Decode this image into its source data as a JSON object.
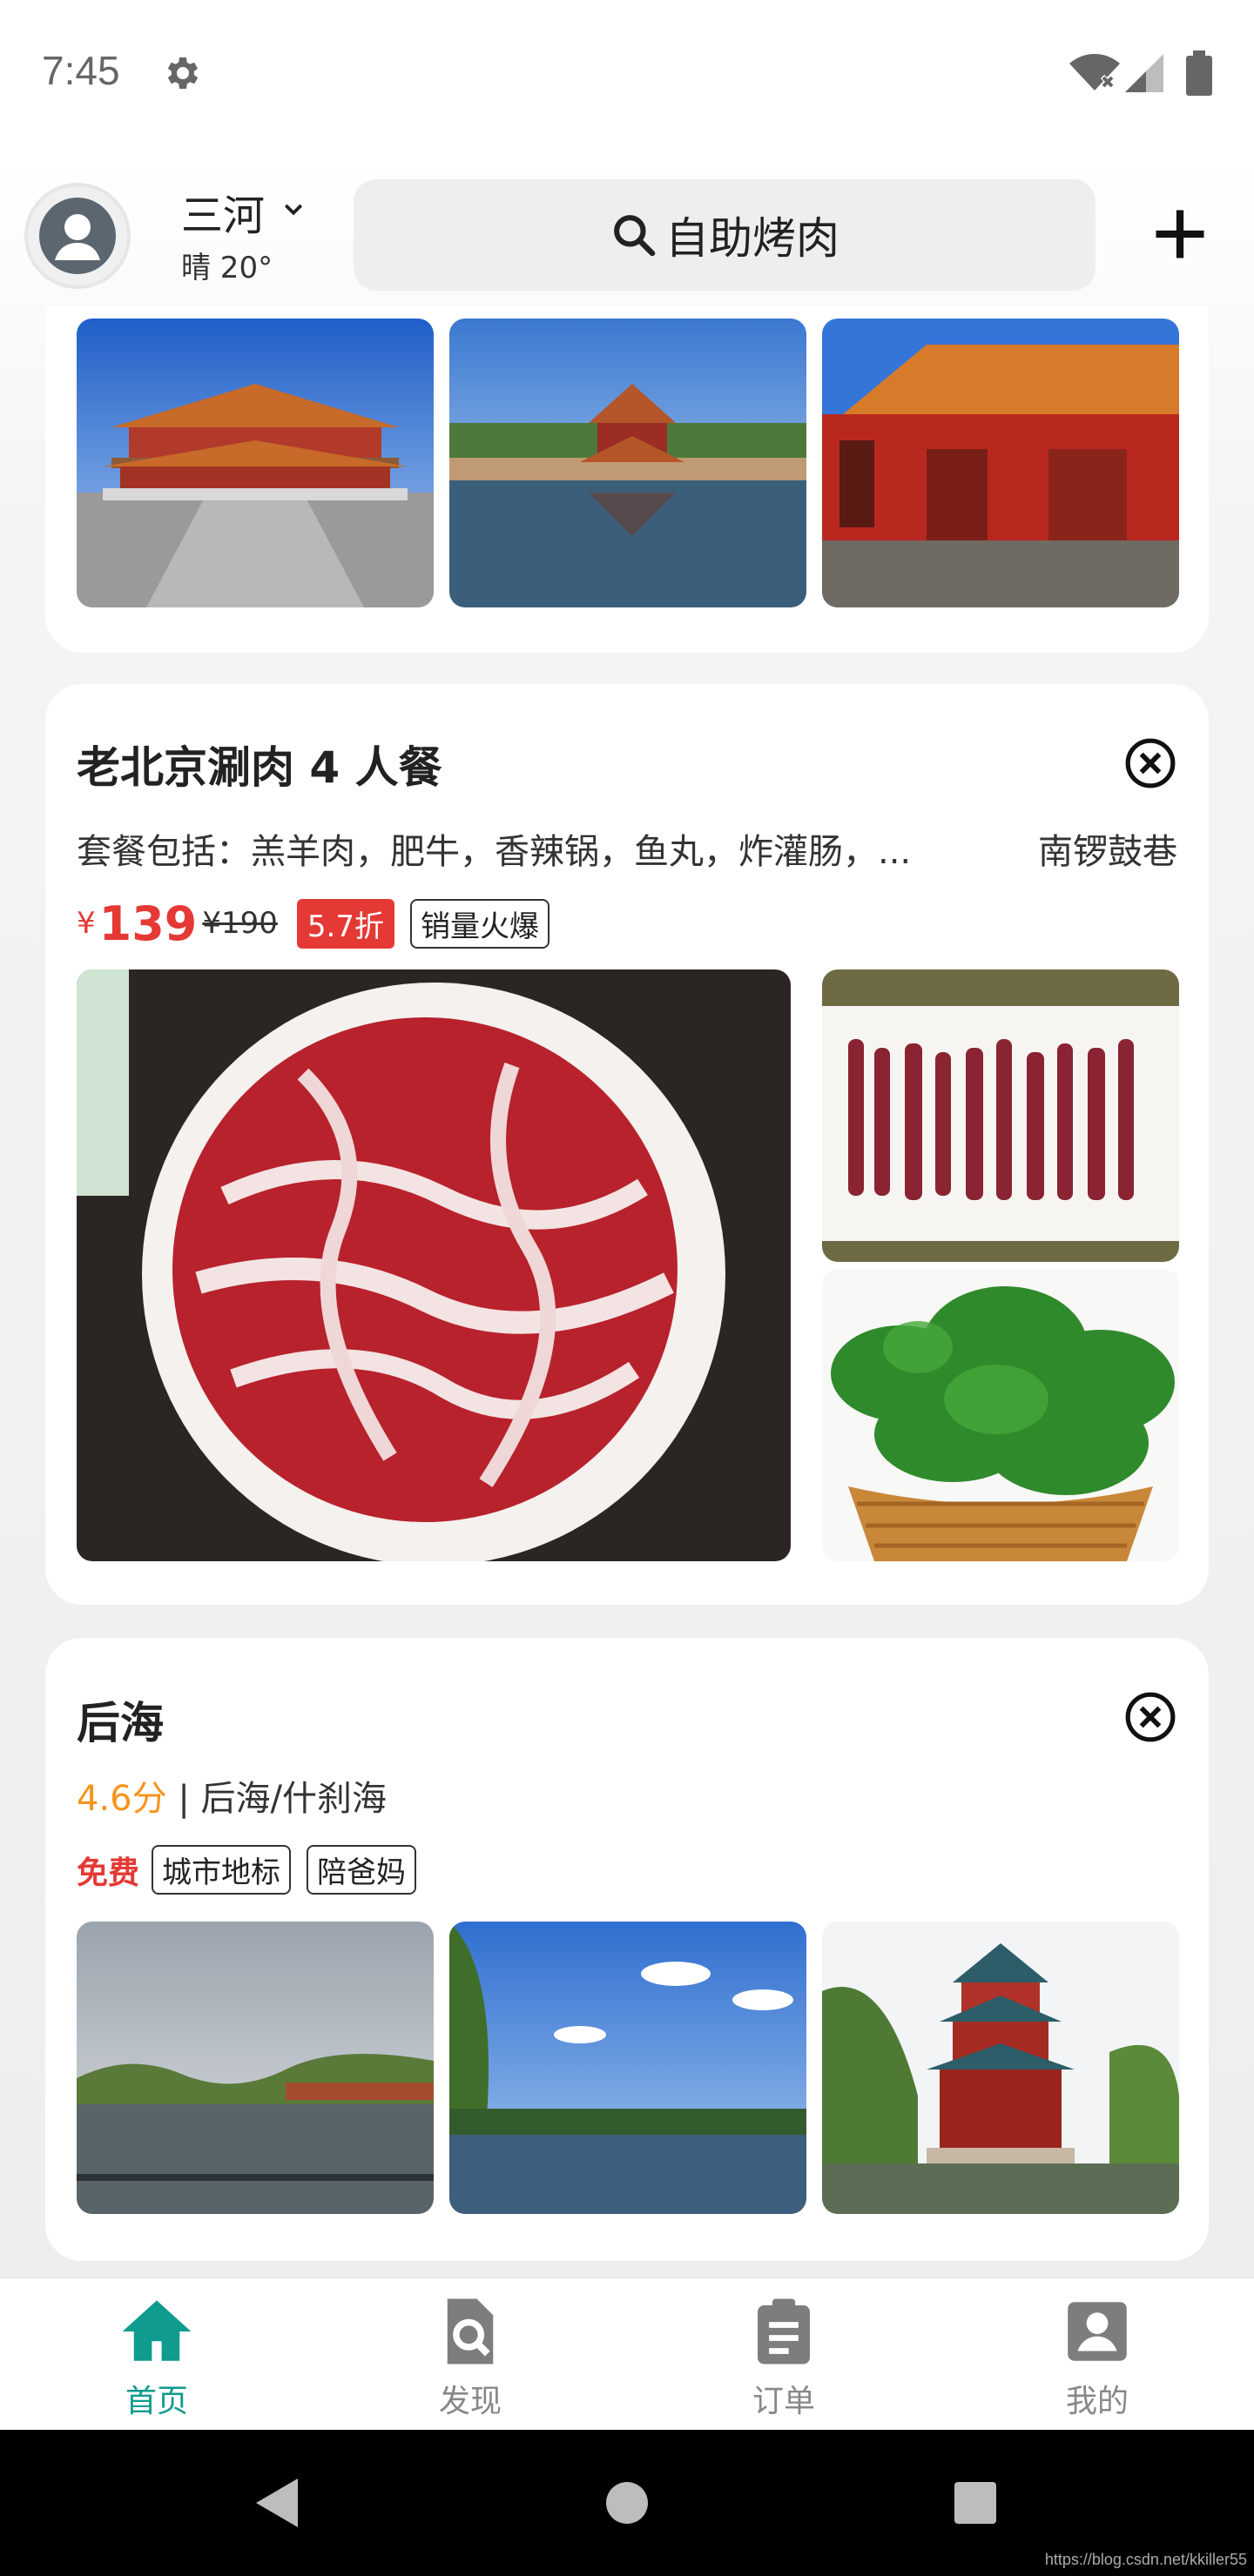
{
  "status_bar": {
    "time": "7:45",
    "icons": [
      "gear-icon",
      "wifi-icon",
      "signal-icon",
      "battery-icon"
    ]
  },
  "header": {
    "city": "三河",
    "weather": "晴 20°",
    "search_text": "自助烤肉",
    "icons": [
      "avatar-icon",
      "chevron-down-icon",
      "search-icon",
      "plus-icon"
    ]
  },
  "card_top": {
    "photos": [
      "故宫太和殿",
      "故宫角楼",
      "故宫宫殿"
    ]
  },
  "hotpot_card": {
    "title": "老北京涮肉 4 人餐",
    "description": "套餐包括：羔羊肉，肥牛，香辣锅，鱼丸，炸灌肠，...",
    "location": "南锣鼓巷",
    "price_symbol": "¥",
    "price": "139",
    "original_price": "¥190",
    "discount": "5.7折",
    "tag": "销量火爆"
  },
  "houhai_card": {
    "title": "后海",
    "rating": "4.6分",
    "area": " | 后海/什刹海",
    "free": "免费",
    "tags": [
      "城市地标",
      "陪爸妈"
    ]
  },
  "bottom_nav": [
    {
      "label": "首页",
      "icon": "home-icon",
      "active": true
    },
    {
      "label": "发现",
      "icon": "discover-icon",
      "active": false
    },
    {
      "label": "订单",
      "icon": "orders-icon",
      "active": false
    },
    {
      "label": "我的",
      "icon": "profile-icon",
      "active": false
    }
  ],
  "watermark": "https://blog.csdn.net/kkiller55",
  "colors": {
    "accent": "#0f9b8e",
    "price_red": "#e53935",
    "rating_orange": "#f7941d"
  }
}
